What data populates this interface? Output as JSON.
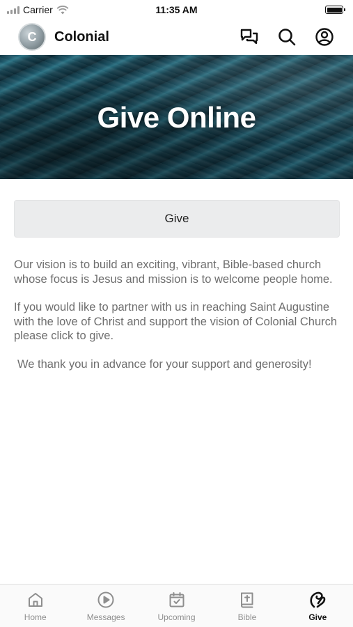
{
  "status_bar": {
    "carrier": "Carrier",
    "time": "11:35 AM"
  },
  "header": {
    "logo_letter": "C",
    "title": "Colonial",
    "icons": [
      "chat-icon",
      "search-icon",
      "profile-icon"
    ]
  },
  "hero": {
    "title": "Give Online"
  },
  "content": {
    "give_button_label": "Give",
    "paragraphs": [
      "Our vision is to build an exciting, vibrant, Bible-based church whose focus is Jesus and mission is to welcome people home.",
      "If you would like to partner with us in reaching Saint Augustine with the love of Christ and support the vision of Colonial Church please click to give.",
      "We thank you in advance for your support and generosity!"
    ]
  },
  "tab_bar": {
    "items": [
      {
        "label": "Home",
        "icon": "home-icon",
        "active": false
      },
      {
        "label": "Messages",
        "icon": "play-icon",
        "active": false
      },
      {
        "label": "Upcoming",
        "icon": "calendar-icon",
        "active": false
      },
      {
        "label": "Bible",
        "icon": "bible-icon",
        "active": false
      },
      {
        "label": "Give",
        "icon": "give-icon",
        "active": true
      }
    ]
  },
  "colors": {
    "accent": "#111111",
    "inactive": "#8e8e8e",
    "button_bg": "#ebeced",
    "body_text": "#6e6e6e"
  }
}
